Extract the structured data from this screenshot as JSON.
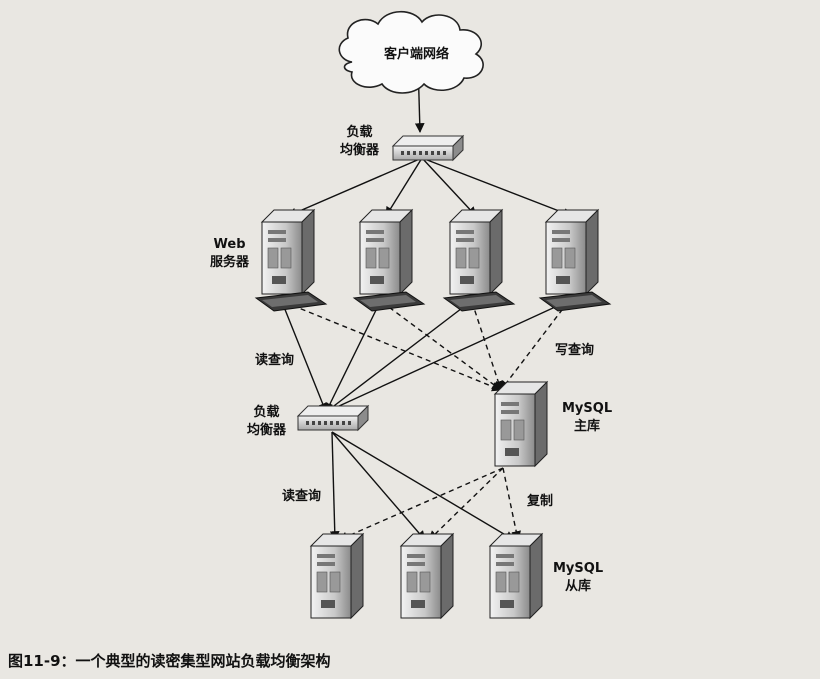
{
  "nodes": {
    "cloud": "客户端网络",
    "lb_top": "负载\n均衡器",
    "web": "Web\n服务器",
    "lb_mid": "负载\n均衡器",
    "master": "MySQL\n主库",
    "slave": "MySQL\n从库"
  },
  "edges": {
    "read_top": "读查询",
    "write": "写查询",
    "read_bottom": "读查询",
    "replication": "复制"
  },
  "caption": "图11-9：一个典型的读密集型网站负载均衡架构",
  "colors": {
    "background": "#e9e7e2",
    "line": "#111111",
    "server_light": "#d9d9d9",
    "server_dark": "#6b6b6b"
  }
}
